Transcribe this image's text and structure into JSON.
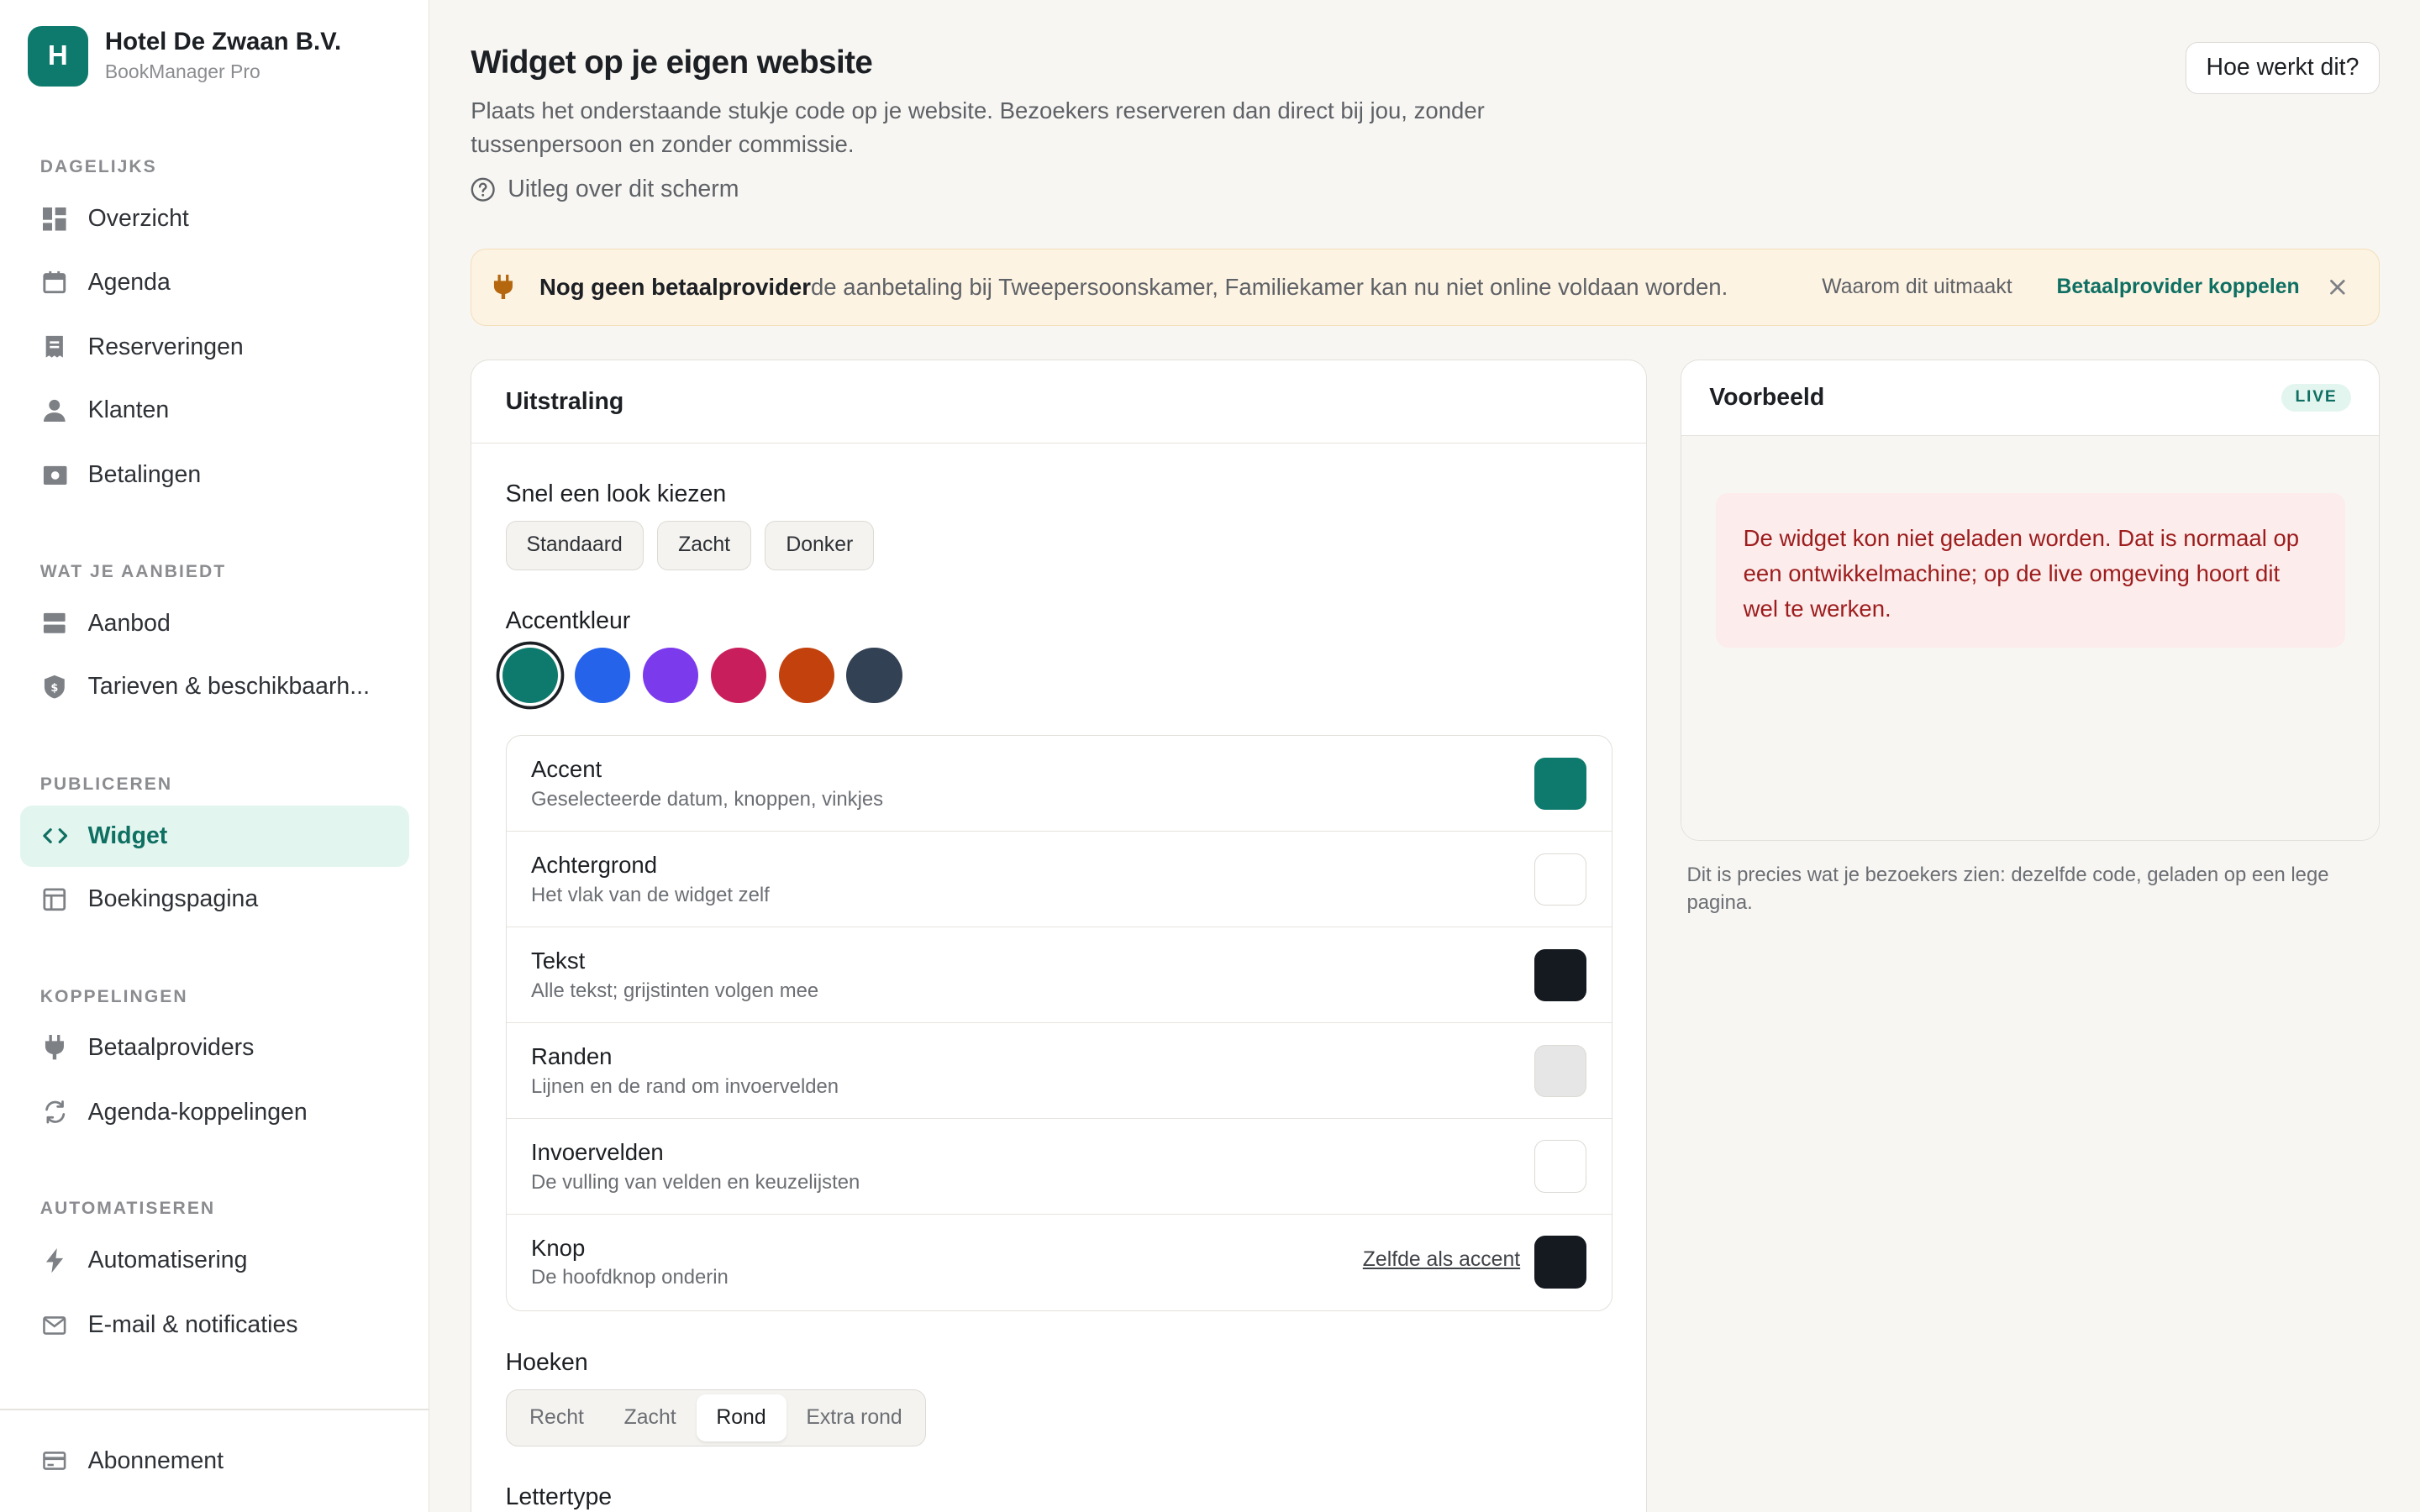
{
  "brand": {
    "initial": "H",
    "name": "Hotel De Zwaan B.V.",
    "subtitle": "BookManager Pro",
    "color": "#0e7a6d"
  },
  "sidebar": {
    "sections": [
      {
        "title": "DAGELIJKS",
        "items": [
          {
            "label": "Overzicht",
            "icon": "grid-icon"
          },
          {
            "label": "Agenda",
            "icon": "calendar-icon"
          },
          {
            "label": "Reserveringen",
            "icon": "receipt-icon"
          },
          {
            "label": "Klanten",
            "icon": "person-icon"
          },
          {
            "label": "Betalingen",
            "icon": "banknote-icon"
          }
        ]
      },
      {
        "title": "WAT JE AANBIEDT",
        "items": [
          {
            "label": "Aanbod",
            "icon": "stack-icon"
          },
          {
            "label": "Tarieven & beschikbaarh...",
            "icon": "shield-icon"
          }
        ]
      },
      {
        "title": "PUBLICEREN",
        "items": [
          {
            "label": "Widget",
            "icon": "code-icon",
            "active": true
          },
          {
            "label": "Boekingspagina",
            "icon": "layout-icon"
          }
        ]
      },
      {
        "title": "KOPPELINGEN",
        "items": [
          {
            "label": "Betaalproviders",
            "icon": "plug-icon"
          },
          {
            "label": "Agenda-koppelingen",
            "icon": "sync-icon"
          }
        ]
      },
      {
        "title": "AUTOMATISEREN",
        "items": [
          {
            "label": "Automatisering",
            "icon": "bolt-icon"
          },
          {
            "label": "E-mail & notificaties",
            "icon": "mail-icon"
          }
        ]
      }
    ],
    "footer_item": {
      "label": "Abonnement",
      "icon": "card-icon"
    }
  },
  "header": {
    "title": "Widget op je eigen website",
    "description": "Plaats het onderstaande stukje code op je website. Bezoekers reserveren dan direct bij jou, zonder tussenpersoon en zonder commissie.",
    "help_link": "Uitleg over dit scherm",
    "how_button": "Hoe werkt dit?"
  },
  "alert": {
    "title": "Nog geen betaalprovider",
    "message": "de aanbetaling bij Tweepersoonskamer, Familiekamer kan nu niet online voldaan worden.",
    "why_link": "Waarom dit uitmaakt",
    "action_link": "Betaalprovider koppelen"
  },
  "appearance": {
    "card_title": "Uitstraling",
    "presets_label": "Snel een look kiezen",
    "presets": [
      "Standaard",
      "Zacht",
      "Donker"
    ],
    "accent_label": "Accentkleur",
    "accent_swatches": [
      "#0e7a6d",
      "#2563eb",
      "#7c3aed",
      "#c81e5b",
      "#c2410c",
      "#334155"
    ],
    "colors": [
      {
        "title": "Accent",
        "description": "Geselecteerde datum, knoppen, vinkjes",
        "value": "#0e7a6d"
      },
      {
        "title": "Achtergrond",
        "description": "Het vlak van de widget zelf",
        "value": "#ffffff"
      },
      {
        "title": "Tekst",
        "description": "Alle tekst; grijstinten volgen mee",
        "value": "#141a20"
      },
      {
        "title": "Randen",
        "description": "Lijnen en de rand om invoervelden",
        "value": "#e6e6e6"
      },
      {
        "title": "Invoervelden",
        "description": "De vulling van velden en keuzelijsten",
        "value": "#ffffff"
      },
      {
        "title": "Knop",
        "description": "De hoofdknop onderin",
        "value": "#141a20",
        "link": "Zelfde als accent"
      }
    ],
    "corners_label": "Hoeken",
    "corners_options": [
      "Recht",
      "Zacht",
      "Rond",
      "Extra rond"
    ],
    "corners_selected": "Rond",
    "font_label": "Lettertype"
  },
  "preview": {
    "title": "Voorbeeld",
    "badge": "LIVE",
    "error": "De widget kon niet geladen worden. Dat is normaal op een ontwikkelmachine; op de live omgeving hoort dit wel te werken.",
    "note": "Dit is precies wat je bezoekers zien: dezelfde code, geladen op een lege pagina."
  }
}
